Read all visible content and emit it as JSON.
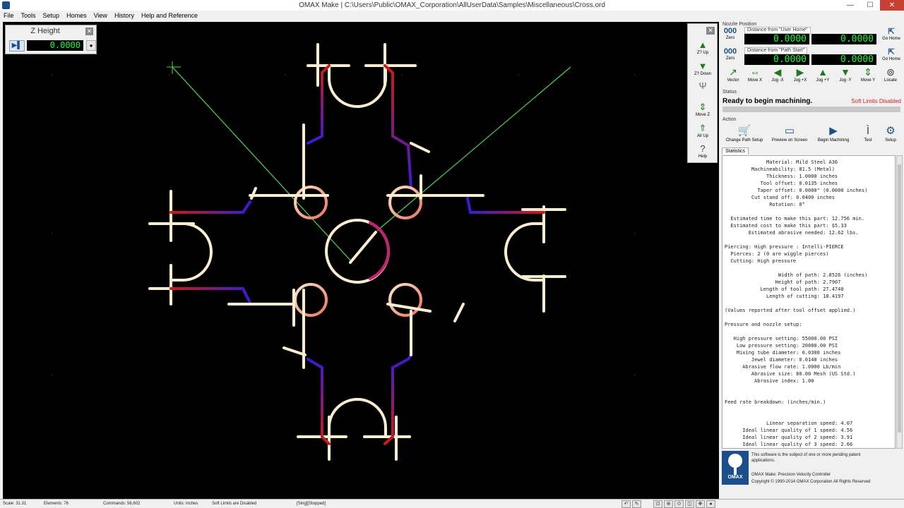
{
  "window": {
    "title": "OMAX Make | C:\\Users\\Public\\OMAX_Corporation\\AllUserData\\Samples\\Miscellaneous\\Cross.ord",
    "controls": {
      "minimize": "—",
      "maximize": "☐",
      "close": "✕"
    }
  },
  "menu": [
    "File",
    "Tools",
    "Setup",
    "Homes",
    "View",
    "History",
    "Help and Reference"
  ],
  "z_panel": {
    "title": "Z Height",
    "value": "0.0000",
    "more": "●"
  },
  "right_toolbar": [
    {
      "label": "Z? Up",
      "icon": "arrow-up-icon"
    },
    {
      "label": "Z? Down",
      "icon": "arrow-down-icon"
    },
    {
      "label": "",
      "icon": "nozzle-icon"
    },
    {
      "label": "Move Z",
      "icon": "move-z-icon"
    },
    {
      "label": "All Up",
      "icon": "all-up-icon"
    },
    {
      "label": "Help",
      "icon": "help-icon"
    }
  ],
  "nozzle_position": {
    "title": "Nozzle Position",
    "user_home_label": "Distance from \"User Home\"",
    "path_start_label": "Distance from \"Path Start\"",
    "user_home_x": "0.0000",
    "user_home_y": "0.0000",
    "path_start_x": "0.0000",
    "path_start_y": "0.0000",
    "zero_label": "Zero",
    "go_home": "Go Home",
    "go_start": "Go Home"
  },
  "jog_buttons": [
    "Vector",
    "Move X",
    "Jog -X",
    "Jog +X",
    "Jog +Y",
    "Jog -Y",
    "Move Y",
    "Locate"
  ],
  "status": {
    "title": "Status",
    "message": "Ready to begin machining.",
    "soft_limits": "Soft Limits Disabled"
  },
  "action": {
    "title": "Action",
    "buttons": [
      "Change Path Setup",
      "Preview on Screen",
      "Begin Machining",
      "Test",
      "Setup"
    ]
  },
  "tabs": [
    "Statistics"
  ],
  "statistics": [
    "              Material: Mild Steel A36",
    "         Machineability: 81.5 (Metal)",
    "              Thickness: 1.0000 inches",
    "            Tool offset: 0.0135 inches",
    "           Taper offset: 0.0000\" (0.0000 inches)",
    "         Cut stand off: 0.0400 inches",
    "               Rotation: 0°",
    "",
    "  Estimated time to make this part: 12.756 min.",
    "  Estimated cost to make this part: $5.33",
    "        Estimated abrasive needed: 12.62 lbs.",
    "",
    "Piercing: High pressure : Intelli-PIERCE",
    "  Pierces: 2 (0 are wiggle pierces)",
    "  Cutting: High pressure",
    "",
    "                  Width of path: 2.8526 (inches)",
    "                 Height of path: 2.7907",
    "            Length of tool path: 27.4740",
    "              Length of cutting: 18.4197",
    "",
    "(Values reported after tool offset applied.)",
    "",
    "Pressure and nozzle setup:",
    "",
    "   High pressure setting: 55000.00 PSI",
    "    Low pressure setting: 20000.00 PSI",
    "    Mixing tube diameter: 0.0300 inches",
    "         Jewel diameter: 0.0140 inches",
    "      Abrasive flow rate: 1.0000 Lb/min",
    "         Abrasive size: 80.00 Mesh (US Std.)",
    "          Abrasive index: 1.00",
    "",
    "",
    "Feed rate breakdown: (inches/min.)",
    "",
    "",
    "              Linear separation speed: 4.07",
    "      Ideal linear quality of 1 speed: 4.56",
    "      Ideal linear quality of 2 speed: 3.91",
    "      Ideal linear quality of 3 speed: 2.66"
  ],
  "about": {
    "patent": "This software is the subject of one or more pending patent",
    "patent2": "applications.",
    "product": "OMAX Make: Precision Velocity Controller",
    "copyright": "Copyright © 1990-2014 OMAX Corporation All Rights Reserved",
    "logo_text": "OMAX"
  },
  "statusbar": {
    "scale": "Scale: 31.31",
    "elements": "Elements: 76",
    "commands": "Commands: 56,602",
    "units": "Units: inches",
    "soft_limits": "Soft Limits are Disabled",
    "mode": "[Sing][Stopped]"
  }
}
